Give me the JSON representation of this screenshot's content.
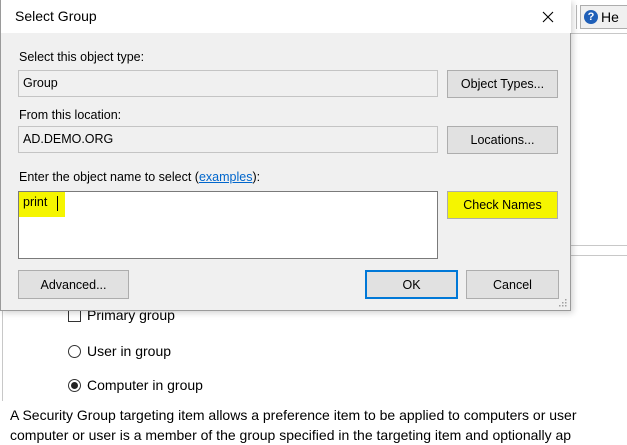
{
  "background_window": {
    "toolbar": {
      "help_label": "He"
    },
    "options": [
      {
        "label": "Primary group",
        "control": "checkbox",
        "checked": false
      },
      {
        "label": "User in group",
        "control": "radio",
        "checked": false
      },
      {
        "label": "Computer in group",
        "control": "radio",
        "checked": true
      }
    ],
    "description_line1": "A Security Group targeting item allows a preference item to be applied to computers or user",
    "description_line2": "computer or user is a member of the group specified in the targeting item and optionally ap"
  },
  "dialog": {
    "title": "Select Group",
    "object_type_label": "Select this object type:",
    "object_type_value": "Group",
    "object_types_button": "Object Types...",
    "location_label": "From this location:",
    "location_value": "AD.DEMO.ORG",
    "locations_button": "Locations...",
    "enter_label_prefix": "Enter the object name to select (",
    "enter_label_link": "examples",
    "enter_label_suffix": "):",
    "object_name_value": "print",
    "check_names_button": "Check Names",
    "advanced_button": "Advanced...",
    "ok_button": "OK",
    "cancel_button": "Cancel"
  },
  "colors": {
    "highlight": "#f5f500",
    "default_button_border": "#0078d7",
    "link": "#0066cc"
  }
}
